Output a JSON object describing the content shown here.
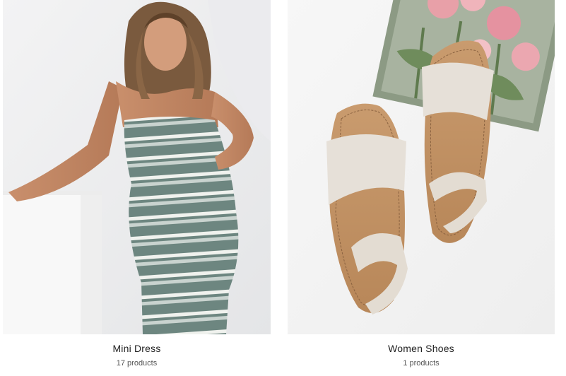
{
  "collections": [
    {
      "title": "Mini Dress",
      "count": "17 products"
    },
    {
      "title": "Women Shoes",
      "count": "1 products"
    }
  ]
}
